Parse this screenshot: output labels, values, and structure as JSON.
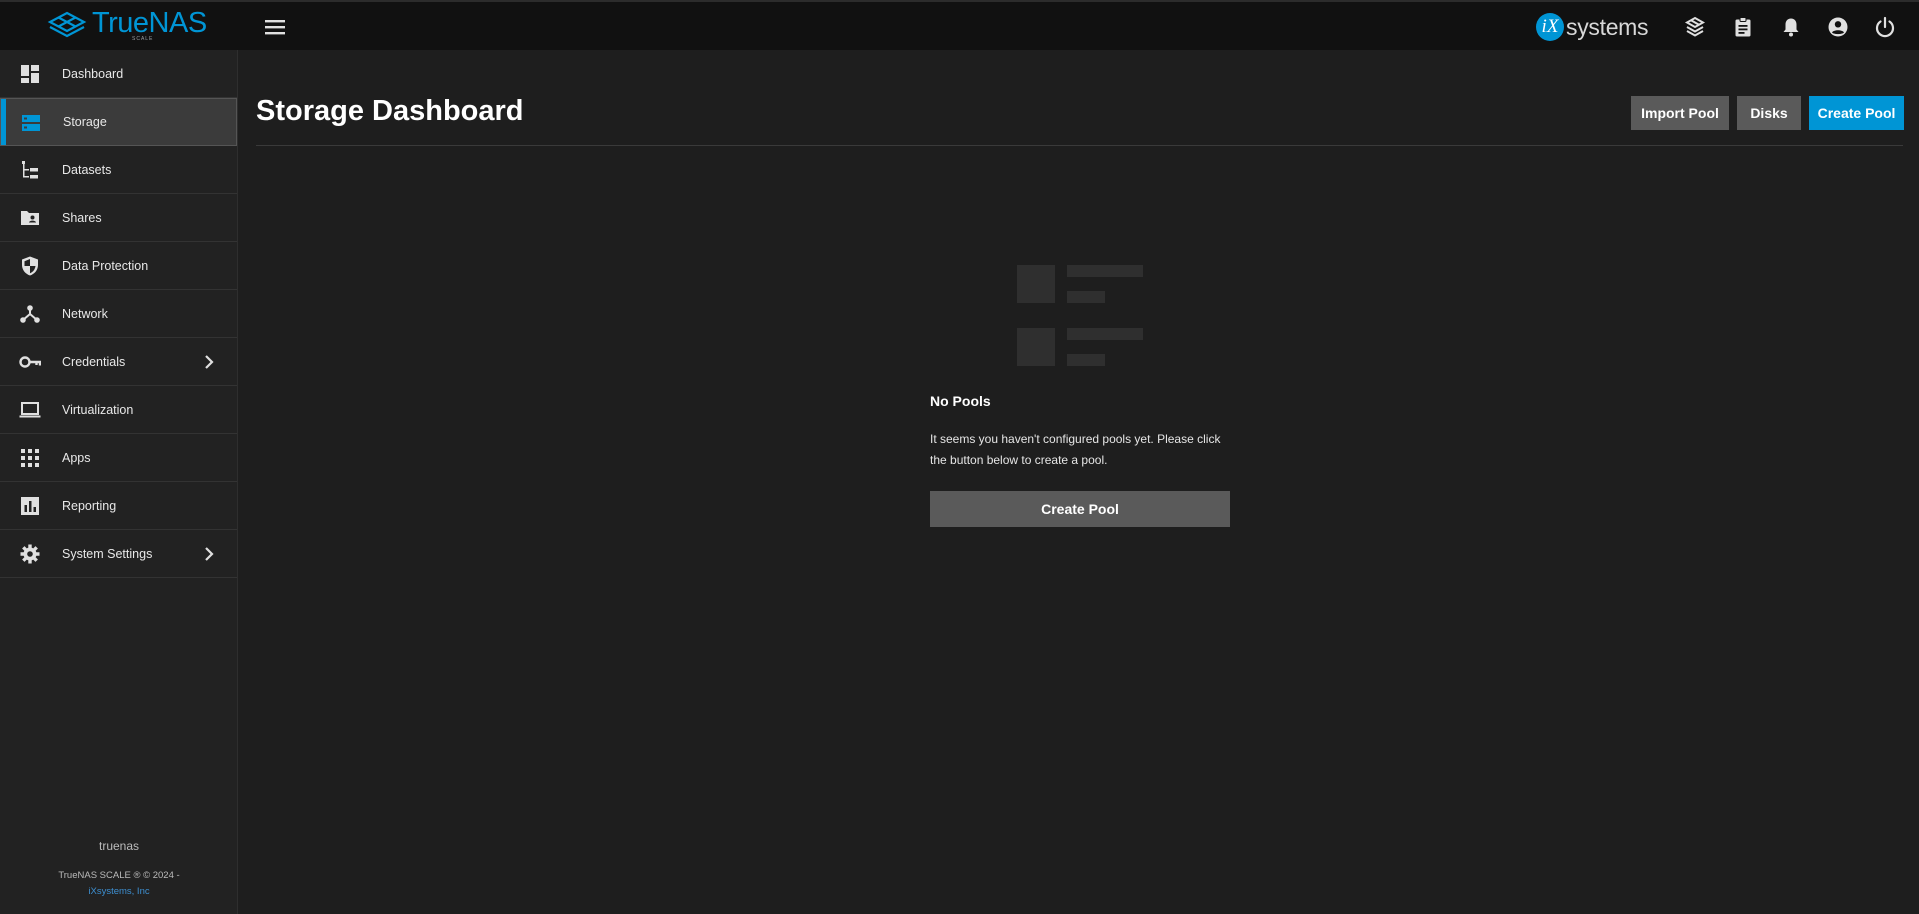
{
  "app": {
    "logo_word": "TrueNAS",
    "logo_sub": "SCALE",
    "brand_color": "#0095d5",
    "vendor_mark": "iX",
    "vendor_word": "systems"
  },
  "topbar": {
    "icons": [
      "menu-icon",
      "truecommand-icon",
      "jobs-icon",
      "notifications-icon",
      "account-icon",
      "power-icon"
    ]
  },
  "sidebar": {
    "items": [
      {
        "label": "Dashboard",
        "icon": "dashboard-icon"
      },
      {
        "label": "Storage",
        "icon": "storage-icon",
        "active": true
      },
      {
        "label": "Datasets",
        "icon": "datasets-icon"
      },
      {
        "label": "Shares",
        "icon": "shares-icon"
      },
      {
        "label": "Data Protection",
        "icon": "shield-icon"
      },
      {
        "label": "Network",
        "icon": "network-icon"
      },
      {
        "label": "Credentials",
        "icon": "key-icon",
        "has_submenu": true
      },
      {
        "label": "Virtualization",
        "icon": "laptop-icon"
      },
      {
        "label": "Apps",
        "icon": "apps-grid-icon"
      },
      {
        "label": "Reporting",
        "icon": "reporting-icon"
      },
      {
        "label": "System Settings",
        "icon": "gear-icon",
        "has_submenu": true
      }
    ],
    "footer": {
      "hostname": "truenas",
      "copyright": "TrueNAS SCALE ® © 2024 -",
      "company": "iXsystems, Inc"
    }
  },
  "main": {
    "title": "Storage Dashboard",
    "actions": {
      "import_pool": "Import Pool",
      "disks": "Disks",
      "create_pool": "Create Pool"
    },
    "empty_state": {
      "title": "No Pools",
      "message": "It seems you haven't configured pools yet. Please click the button below to create a pool.",
      "button": "Create Pool"
    }
  }
}
